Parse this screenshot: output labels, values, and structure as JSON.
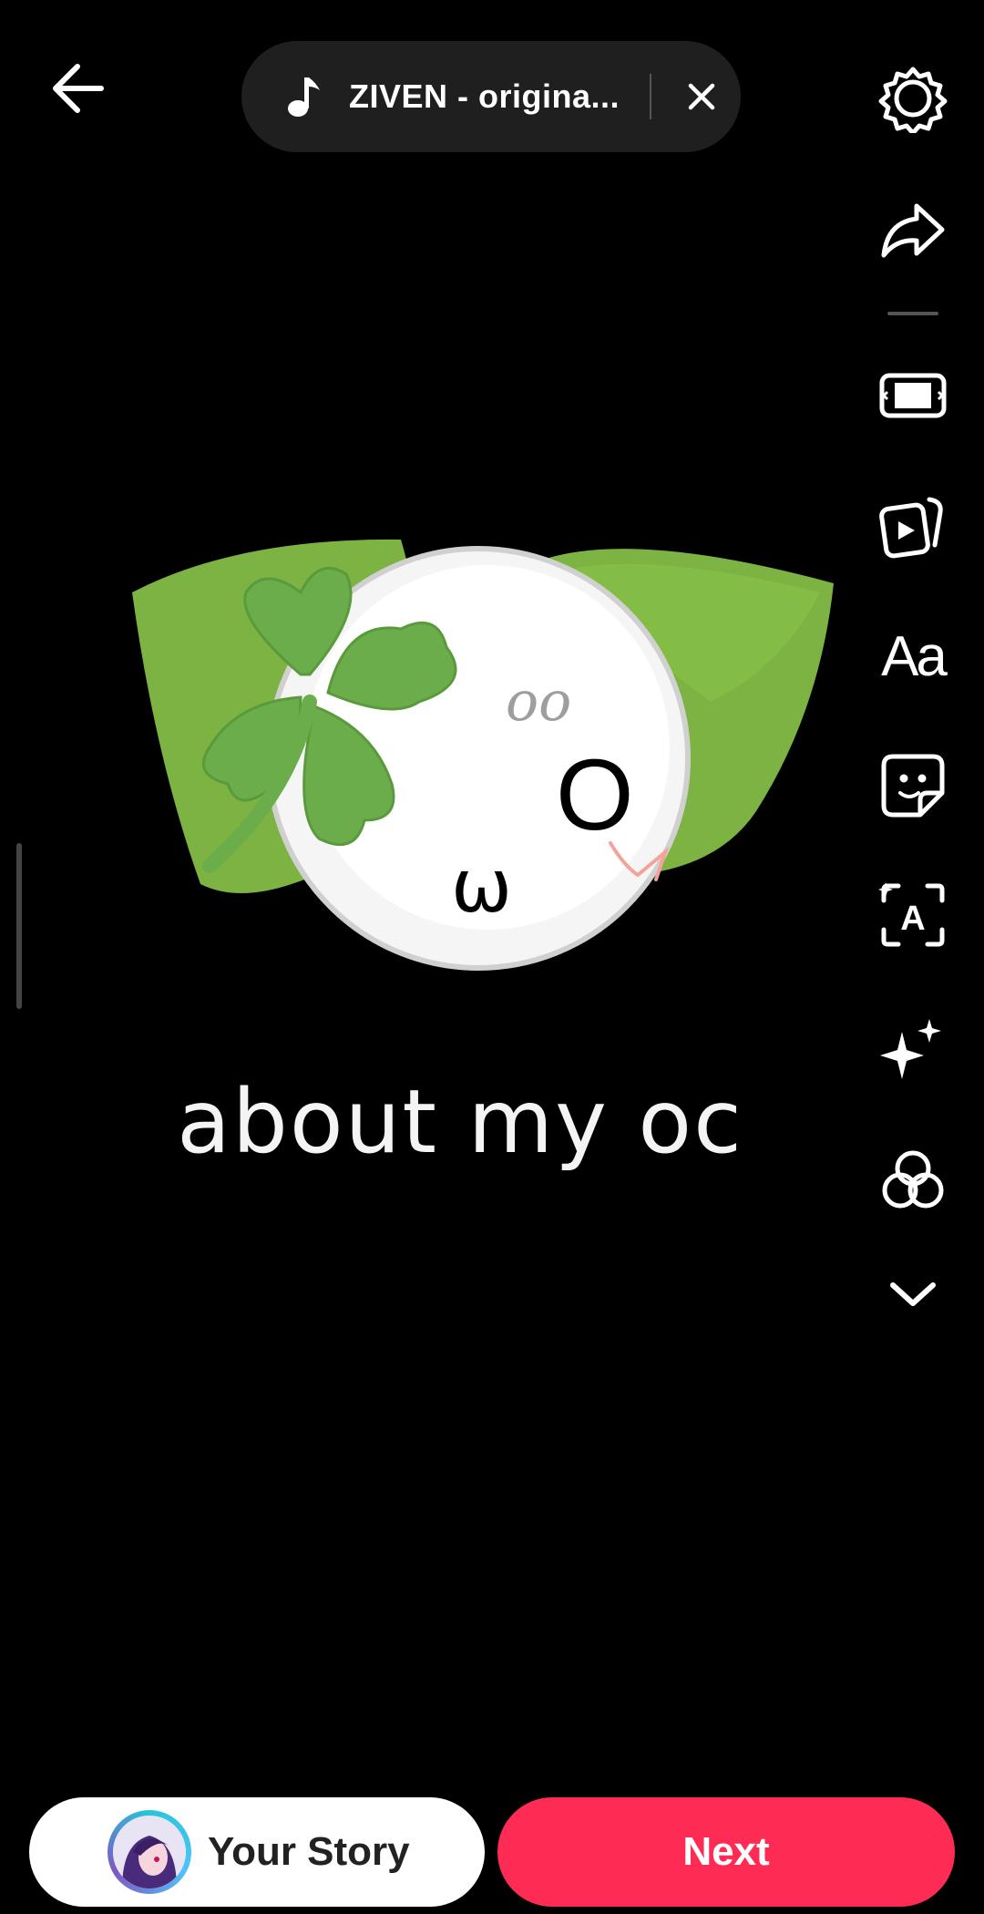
{
  "header": {
    "back_icon": "arrow-left-icon",
    "sound": {
      "icon": "music-note-icon",
      "label": "ZIVEN - origina...",
      "remove_icon": "close-icon"
    }
  },
  "toolbar": {
    "items": [
      {
        "name": "settings",
        "icon": "gear-icon"
      },
      {
        "name": "share",
        "icon": "share-arrow-icon"
      },
      {
        "name": "adjust-clips",
        "icon": "crop-frame-icon"
      },
      {
        "name": "templates",
        "icon": "video-cards-icon"
      },
      {
        "name": "text",
        "icon": "text-icon",
        "label": "Aa"
      },
      {
        "name": "stickers",
        "icon": "sticker-icon"
      },
      {
        "name": "captions",
        "icon": "auto-caption-icon",
        "label": "A"
      },
      {
        "name": "effects",
        "icon": "sparkle-icon"
      },
      {
        "name": "filters",
        "icon": "filters-icon"
      },
      {
        "name": "more",
        "icon": "chevron-down-icon"
      }
    ]
  },
  "canvas": {
    "artwork_face": {
      "eyes": "oo",
      "eye": "O",
      "mouth": "ω"
    },
    "caption": "about my oc"
  },
  "footer": {
    "story_button": "Your Story",
    "next_button": "Next"
  },
  "colors": {
    "accent": "#fe2c55",
    "background": "#000000",
    "leaf": "#7cb342",
    "clover": "#6aad4a"
  }
}
